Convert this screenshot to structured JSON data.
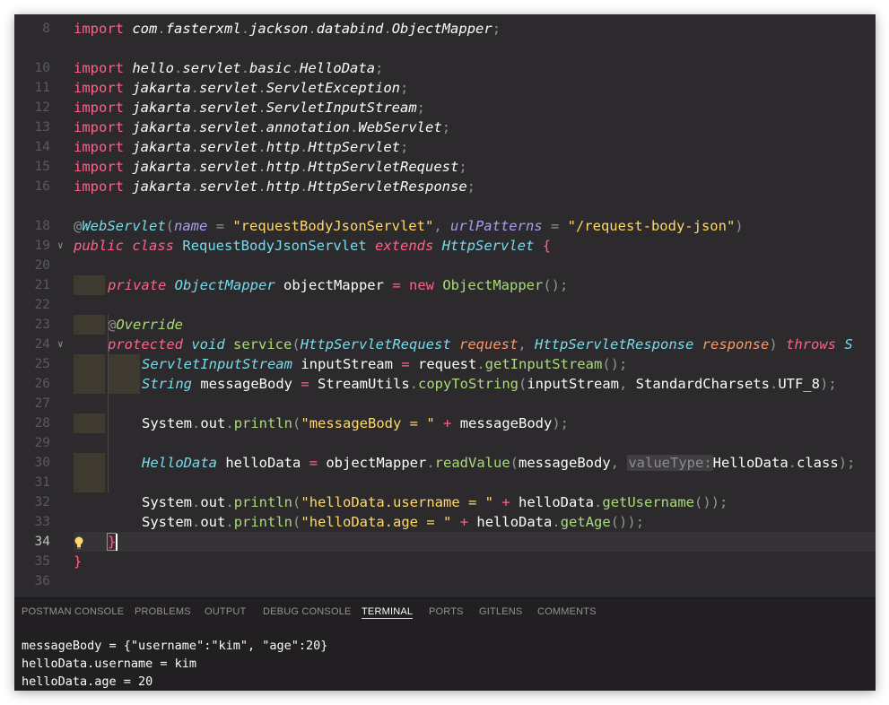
{
  "editor": {
    "line_numbers": [
      "8",
      "10",
      "11",
      "12",
      "13",
      "14",
      "15",
      "16",
      "18",
      "19",
      "20",
      "21",
      "22",
      "23",
      "24",
      "25",
      "26",
      "27",
      "28",
      "29",
      "30",
      "31",
      "32",
      "33",
      "34",
      "35",
      "36"
    ],
    "imports": [
      {
        "kw": "import",
        "pkg": [
          "com",
          "fasterxml",
          "jackson",
          "databind"
        ],
        "cls": "ObjectMapper"
      },
      {
        "kw": "import",
        "pkg": [
          "hello",
          "servlet",
          "basic"
        ],
        "cls": "HelloData"
      },
      {
        "kw": "import",
        "pkg": [
          "jakarta",
          "servlet"
        ],
        "cls": "ServletException"
      },
      {
        "kw": "import",
        "pkg": [
          "jakarta",
          "servlet"
        ],
        "cls": "ServletInputStream"
      },
      {
        "kw": "import",
        "pkg": [
          "jakarta",
          "servlet",
          "annotation"
        ],
        "cls": "WebServlet"
      },
      {
        "kw": "import",
        "pkg": [
          "jakarta",
          "servlet",
          "http"
        ],
        "cls": "HttpServlet"
      },
      {
        "kw": "import",
        "pkg": [
          "jakarta",
          "servlet",
          "http"
        ],
        "cls": "HttpServletRequest"
      },
      {
        "kw": "import",
        "pkg": [
          "jakarta",
          "servlet",
          "http"
        ],
        "cls": "HttpServletResponse"
      }
    ],
    "annotation": {
      "at": "@",
      "name": "WebServlet",
      "attr1": "name",
      "val1": "\"requestBodyJsonServlet\"",
      "attr2": "urlPatterns",
      "val2": "\"/request-body-json\""
    },
    "class_decl": {
      "mod": "public",
      "cls_kw": "class",
      "name": "RequestBodyJsonServlet",
      "ext": "extends",
      "parent": "HttpServlet"
    },
    "field": {
      "mod": "private",
      "type": "ObjectMapper",
      "name": "objectMapper",
      "new_kw": "new",
      "ctor": "ObjectMapper"
    },
    "override": {
      "at": "@",
      "name": "Override"
    },
    "method": {
      "mod": "protected",
      "ret": "void",
      "name": "service",
      "ptype1": "HttpServletRequest",
      "pname1": "request",
      "ptype2": "HttpServletResponse",
      "pname2": "response",
      "throws": "throws",
      "tail": "S"
    },
    "l25": {
      "type": "ServletInputStream",
      "var": "inputStream",
      "obj": "request",
      "fn": "getInputStream"
    },
    "l26": {
      "type": "String",
      "var": "messageBody",
      "obj": "StreamUtils",
      "fn": "copyToString",
      "arg1": "inputStream",
      "arg2a": "StandardCharsets",
      "arg2b": "UTF_8"
    },
    "l28": {
      "sys": "System",
      "out": "out",
      "fn": "println",
      "str": "\"messageBody = \"",
      "var": "messageBody"
    },
    "l30": {
      "type": "HelloData",
      "var": "helloData",
      "obj": "objectMapper",
      "fn": "readValue",
      "arg1": "messageBody",
      "hint": "valueType:",
      "arg2a": "HelloData",
      "arg2b": "class"
    },
    "l32": {
      "sys": "System",
      "out": "out",
      "fn": "println",
      "str": "\"helloData.username = \"",
      "obj": "helloData",
      "getter": "getUsername"
    },
    "l33": {
      "sys": "System",
      "out": "out",
      "fn": "println",
      "str": "\"helloData.age = \"",
      "obj": "helloData",
      "getter": "getAge"
    }
  },
  "panel": {
    "tabs": [
      "POSTMAN CONSOLE",
      "PROBLEMS",
      "OUTPUT",
      "DEBUG CONSOLE",
      "TERMINAL",
      "PORTS",
      "GITLENS",
      "COMMENTS"
    ],
    "active_tab": "TERMINAL",
    "terminal_lines": [
      "messageBody = {\"username\":\"kim\", \"age\":20}",
      "helloData.username = kim",
      "helloData.age = 20"
    ]
  },
  "colors": {
    "bg": "#2d2a2e",
    "keyword": "#ff6188",
    "type": "#78dce8",
    "function": "#a9dc76",
    "string": "#ffd866",
    "param": "#fc9867",
    "attr": "#ab9df2"
  }
}
